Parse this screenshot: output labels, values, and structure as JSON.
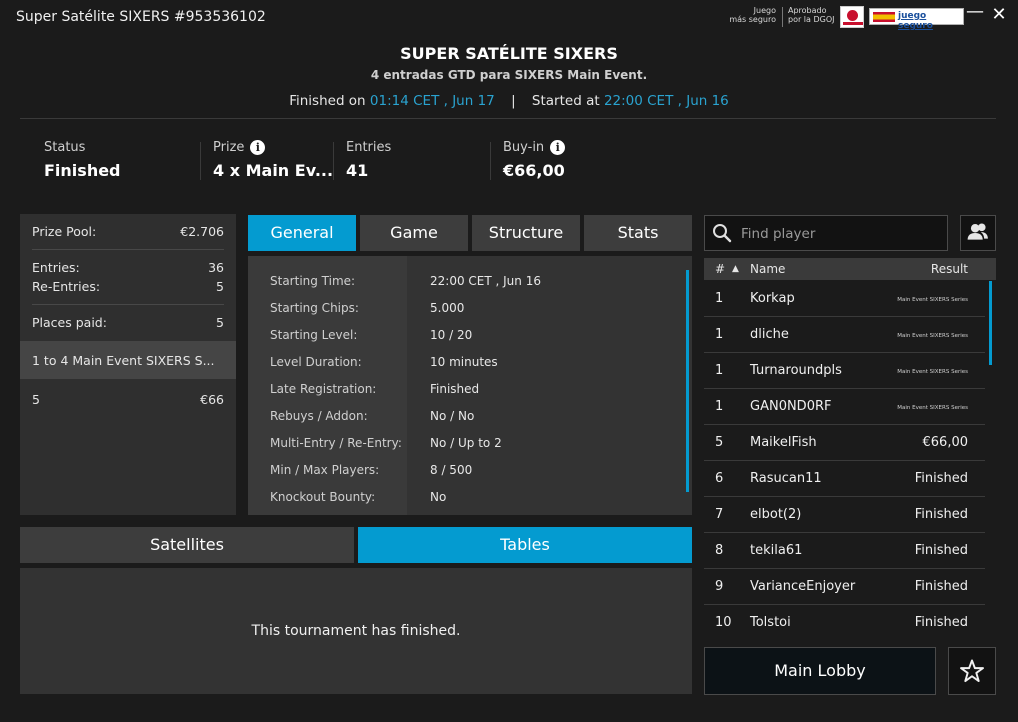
{
  "window": {
    "title": "Super Satélite SIXERS #953536102",
    "badge_line1": "Juego",
    "badge_line2": "más seguro",
    "badge2_line1": "Aprobado",
    "badge2_line2": "por la DGOJ",
    "juego_seguro": "juego seguro",
    "minimize": "—",
    "close": "✕"
  },
  "header": {
    "title": "SUPER SATÉLITE SIXERS",
    "subtitle": "4 entradas GTD para SIXERS Main Event.",
    "finished_label": "Finished on",
    "finished_value": "01:14 CET , Jun 17",
    "separator": "|",
    "started_label": "Started at",
    "started_value": "22:00 CET , Jun 16"
  },
  "summary": {
    "status_label": "Status",
    "status_value": "Finished",
    "prize_label": "Prize",
    "prize_value": "4 x Main Ev...",
    "entries_label": "Entries",
    "entries_value": "41",
    "buyin_label": "Buy-in",
    "buyin_value": "€66,00",
    "info_glyph": "i"
  },
  "prize_panel": {
    "pool_label": "Prize Pool:",
    "pool_value": "€2.706",
    "entries_label": "Entries:",
    "entries_value": "36",
    "reentries_label": "Re-Entries:",
    "reentries_value": "5",
    "places_label": "Places paid:",
    "places_value": "5",
    "payouts": [
      {
        "places": "1  to  4   Main Event SIXERS S...",
        "amount": ""
      },
      {
        "places": "5",
        "amount": "€66"
      }
    ]
  },
  "tabs": [
    {
      "label": "General"
    },
    {
      "label": "Game"
    },
    {
      "label": "Structure"
    },
    {
      "label": "Stats"
    }
  ],
  "general": [
    {
      "key": "Starting Time:",
      "value": "22:00 CET , Jun 16"
    },
    {
      "key": "Starting Chips:",
      "value": "5.000"
    },
    {
      "key": "Starting Level:",
      "value": "10 / 20"
    },
    {
      "key": "Level Duration:",
      "value": "10 minutes"
    },
    {
      "key": "Late Registration:",
      "value": "Finished"
    },
    {
      "key": "Rebuys / Addon:",
      "value": "No / No"
    },
    {
      "key": "Multi-Entry / Re-Entry:",
      "value": "No / Up to 2"
    },
    {
      "key": "Min / Max Players:",
      "value": "8 / 500"
    },
    {
      "key": "Knockout Bounty:",
      "value": "No"
    }
  ],
  "bottom_tabs": {
    "satellites": "Satellites",
    "tables": "Tables",
    "message": "This tournament has finished."
  },
  "players": {
    "search_placeholder": "Find player",
    "col_rank": "#",
    "sort_glyph": "▲",
    "col_name": "Name",
    "col_result": "Result",
    "rows": [
      {
        "rank": "1",
        "name": "Korkap",
        "result": "Main Event SIXERS Series"
      },
      {
        "rank": "1",
        "name": "dliche",
        "result": "Main Event SIXERS Series"
      },
      {
        "rank": "1",
        "name": "Turnaroundpls",
        "result": "Main Event SIXERS Series"
      },
      {
        "rank": "1",
        "name": "GAN0ND0RF",
        "result": "Main Event SIXERS Series"
      },
      {
        "rank": "5",
        "name": "MaikelFish",
        "result": "€66,00"
      },
      {
        "rank": "6",
        "name": "Rasucan11",
        "result": "Finished"
      },
      {
        "rank": "7",
        "name": "elbot(2)",
        "result": "Finished"
      },
      {
        "rank": "8",
        "name": "tekila61",
        "result": "Finished"
      },
      {
        "rank": "9",
        "name": "VarianceEnjoyer",
        "result": "Finished"
      },
      {
        "rank": "10",
        "name": "Tolstoi",
        "result": "Finished"
      }
    ]
  },
  "footer": {
    "lobby_label": "Main Lobby"
  },
  "colors": {
    "accent": "#049bd0",
    "highlight_text": "#2aa3d0",
    "background": "#1b1b1b"
  }
}
